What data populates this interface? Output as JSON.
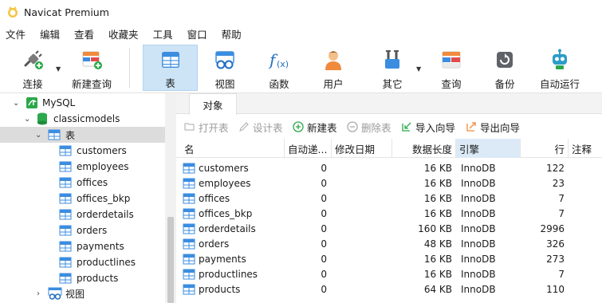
{
  "window": {
    "title": "Navicat Premium"
  },
  "menu": [
    "文件",
    "编辑",
    "查看",
    "收藏夹",
    "工具",
    "窗口",
    "帮助"
  ],
  "toolbar": {
    "connect": "连接",
    "new_query": "新建查询",
    "table": "表",
    "view": "视图",
    "function": "函数",
    "user": "用户",
    "other": "其它",
    "query": "查询",
    "backup": "备份",
    "automation": "自动运行"
  },
  "tree": {
    "connection": "MySQL",
    "database": "classicmodels",
    "tables_node": "表",
    "tables": [
      "customers",
      "employees",
      "offices",
      "offices_bkp",
      "orderdetails",
      "orders",
      "payments",
      "productlines",
      "products"
    ],
    "views_node": "视图"
  },
  "tabs": {
    "objects": "对象"
  },
  "object_toolbar": {
    "open_table": "打开表",
    "design_table": "设计表",
    "new_table": "新建表",
    "delete_table": "删除表",
    "import_wizard": "导入向导",
    "export_wizard": "导出向导"
  },
  "grid": {
    "columns": [
      "名",
      "自动递...",
      "修改日期",
      "数据长度",
      "引擎",
      "行",
      "注释"
    ],
    "rows": [
      {
        "name": "customers",
        "auto_inc": "0",
        "modified": "",
        "data_length": "16 KB",
        "engine": "InnoDB",
        "rows": "122",
        "comment": ""
      },
      {
        "name": "employees",
        "auto_inc": "0",
        "modified": "",
        "data_length": "16 KB",
        "engine": "InnoDB",
        "rows": "23",
        "comment": ""
      },
      {
        "name": "offices",
        "auto_inc": "0",
        "modified": "",
        "data_length": "16 KB",
        "engine": "InnoDB",
        "rows": "7",
        "comment": ""
      },
      {
        "name": "offices_bkp",
        "auto_inc": "0",
        "modified": "",
        "data_length": "16 KB",
        "engine": "InnoDB",
        "rows": "7",
        "comment": ""
      },
      {
        "name": "orderdetails",
        "auto_inc": "0",
        "modified": "",
        "data_length": "160 KB",
        "engine": "InnoDB",
        "rows": "2996",
        "comment": ""
      },
      {
        "name": "orders",
        "auto_inc": "0",
        "modified": "",
        "data_length": "48 KB",
        "engine": "InnoDB",
        "rows": "326",
        "comment": ""
      },
      {
        "name": "payments",
        "auto_inc": "0",
        "modified": "",
        "data_length": "16 KB",
        "engine": "InnoDB",
        "rows": "273",
        "comment": ""
      },
      {
        "name": "productlines",
        "auto_inc": "0",
        "modified": "",
        "data_length": "16 KB",
        "engine": "InnoDB",
        "rows": "7",
        "comment": ""
      },
      {
        "name": "products",
        "auto_inc": "0",
        "modified": "",
        "data_length": "64 KB",
        "engine": "InnoDB",
        "rows": "110",
        "comment": ""
      }
    ]
  },
  "colors": {
    "accent": "#1e7fd8",
    "active_tool": "#cde4f7",
    "sorted_header": "#dceaf7",
    "selected_tree": "#dcdcdc"
  }
}
